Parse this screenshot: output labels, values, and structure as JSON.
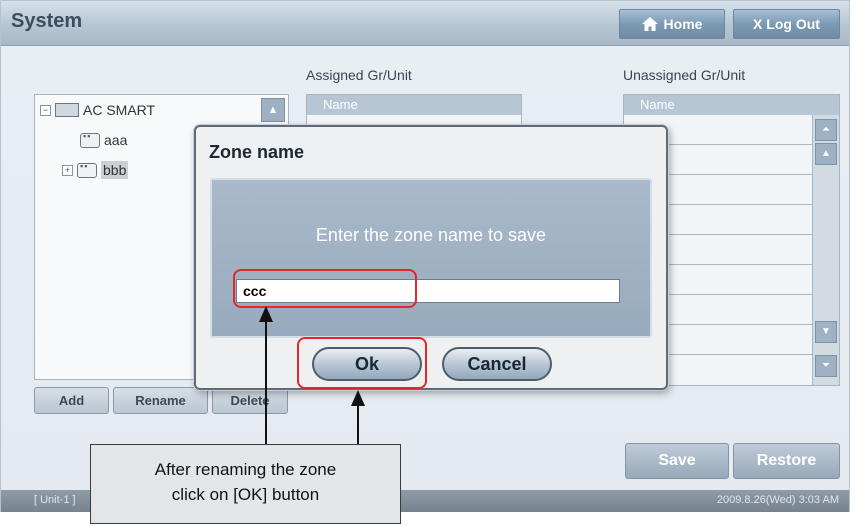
{
  "header": {
    "title": "System",
    "home_label": "Home",
    "logout_label": "X Log Out"
  },
  "columns": {
    "assigned_label": "Assigned Gr/Unit",
    "unassigned_label": "Unassigned Gr/Unit",
    "name_header": "Name"
  },
  "tree": {
    "root": "AC SMART",
    "items": [
      {
        "label": "aaa",
        "expandable": false,
        "selected": false
      },
      {
        "label": "bbb",
        "expandable": true,
        "selected": true
      }
    ]
  },
  "actions": {
    "add": "Add",
    "rename": "Rename",
    "delete": "Delete",
    "save": "Save",
    "restore": "Restore"
  },
  "status": {
    "left": "[ Unit-1 ]",
    "right": "2009.8.26(Wed)  3:03 AM"
  },
  "dialog": {
    "title": "Zone name",
    "prompt": "Enter the zone name to save",
    "input_value": "ccc",
    "ok_label": "Ok",
    "cancel_label": "Cancel"
  },
  "annotation": {
    "line1": "After renaming the zone",
    "line2": "click on [OK] button"
  },
  "colors": {
    "highlight": "#e5262a",
    "titlebar": "#b6c6d4"
  }
}
